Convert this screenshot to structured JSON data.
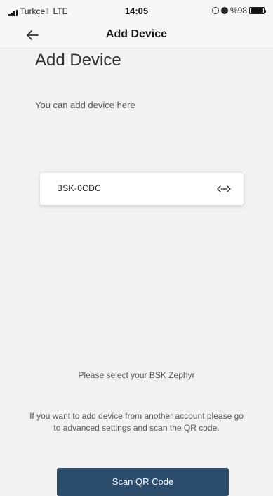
{
  "status_bar": {
    "carrier": "Turkcell",
    "network": "LTE",
    "time": "14:05",
    "battery": "%98",
    "icons": [
      "signal-icon",
      "location-icon",
      "alarm-icon",
      "battery-icon"
    ]
  },
  "header": {
    "back_icon": "arrow-left-icon",
    "title": "Add Device"
  },
  "main": {
    "title": "Add Device",
    "subtitle": "You can add device here",
    "devices": [
      {
        "name": "BSK-0CDC",
        "icon": "connect-arrows-icon"
      }
    ],
    "select_text": "Please select your BSK Zephyr",
    "advanced_text": "If you want to add device from another account please go to advanced settings and scan the QR code.",
    "scan_button": "Scan QR Code"
  },
  "colors": {
    "background": "#f2f2f2",
    "header_background": "#f7f7f7",
    "card_background": "#ffffff",
    "button_background": "#2c4c6c",
    "button_text": "#ffffff"
  }
}
